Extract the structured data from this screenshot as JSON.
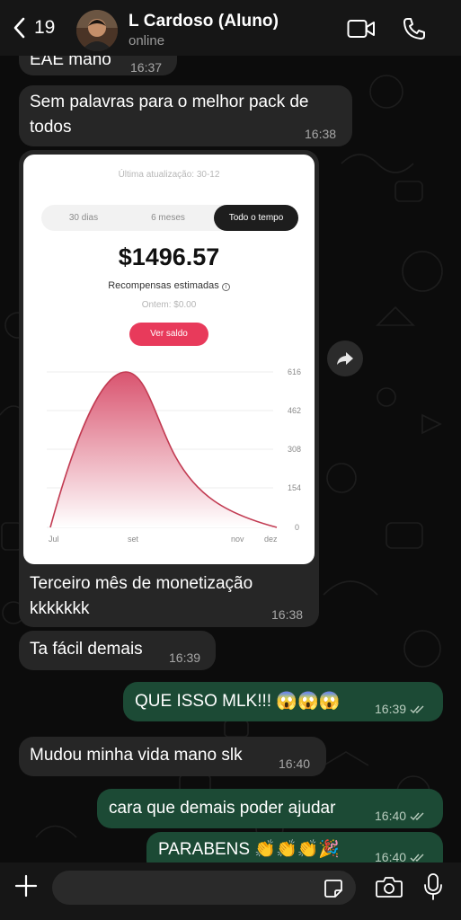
{
  "header": {
    "back_count": "19",
    "contact_name": "L Cardoso (Aluno)",
    "status": "online"
  },
  "messages": [
    {
      "text": "EAE mano",
      "time": "16:37"
    },
    {
      "text": "Sem palavras para o melhor pack de todos",
      "time": "16:38"
    },
    {
      "text": "Terceiro mês de monetização kkkkkkk",
      "time": "16:38"
    },
    {
      "text": "Ta fácil demais",
      "time": "16:39"
    },
    {
      "text": "QUE ISSO MLK!!! 😱😱😱",
      "time": "16:39"
    },
    {
      "text": "Mudou minha vida mano slk",
      "time": "16:40"
    },
    {
      "text": "cara que demais poder ajudar",
      "time": "16:40"
    },
    {
      "text": "PARABENS 👏👏👏🎉",
      "time": "16:40"
    }
  ],
  "screenshot": {
    "updated": "Última atualização: 30-12",
    "tabs": [
      "30 dias",
      "6 meses",
      "Todo o tempo"
    ],
    "active_tab": "Todo o tempo",
    "amount": "$1496.57",
    "rewards_label": "Recompensas estimadas",
    "today": "Ontem: $0.00",
    "button": "Ver saldo",
    "y_ticks": [
      "616",
      "462",
      "308",
      "154",
      "0"
    ],
    "x_ticks": [
      "Jul",
      "set",
      "nov",
      "dez"
    ],
    "accent": "#e83a5b"
  },
  "composer": {
    "placeholder": ""
  },
  "colors": {
    "incoming": "#262626",
    "outgoing": "#1c4a35"
  }
}
